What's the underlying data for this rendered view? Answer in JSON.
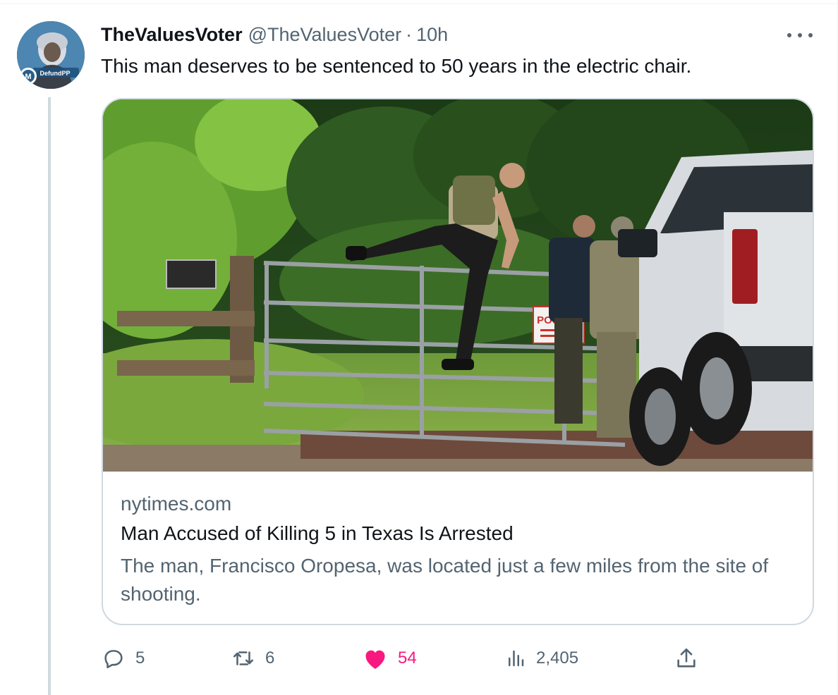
{
  "tweet": {
    "display_name": "TheValuesVoter",
    "handle": "@TheValuesVoter",
    "separator": "·",
    "time": "10h",
    "text": "This man deserves to be sentenced to 50 years in the electric chair.",
    "avatar_badge": "DefundPP",
    "more_icon": "more-horizontal-icon"
  },
  "card": {
    "domain": "nytimes.com",
    "title": "Man Accused of Killing 5 in Texas Is Arrested",
    "description": "The man, Francisco Oropesa, was located just a few miles from the site of shooting.",
    "image_sign": "POSTED"
  },
  "actions": {
    "replies": "5",
    "retweets": "6",
    "likes": "54",
    "views": "2,405",
    "liked": true
  },
  "colors": {
    "text": "#0f1419",
    "secondary": "#536471",
    "like": "#f91880",
    "border": "#cfd9de"
  }
}
